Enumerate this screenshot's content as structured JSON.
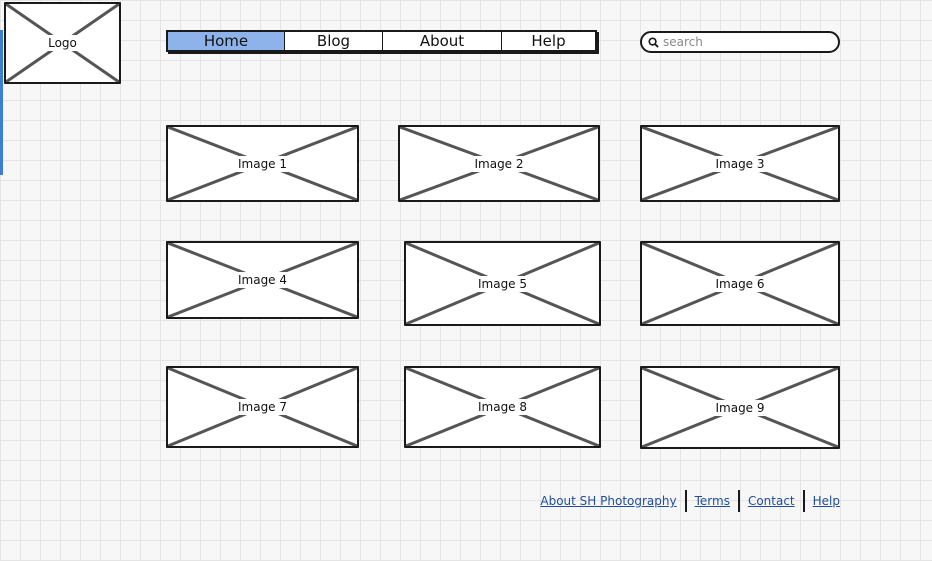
{
  "logo": {
    "label": "Logo"
  },
  "nav": {
    "items": [
      {
        "label": "Home",
        "active": true
      },
      {
        "label": "Blog",
        "active": false
      },
      {
        "label": "About",
        "active": false
      },
      {
        "label": "Help",
        "active": false
      }
    ]
  },
  "search": {
    "placeholder": "search",
    "value": ""
  },
  "gallery": {
    "images": [
      {
        "label": "Image 1"
      },
      {
        "label": "Image 2"
      },
      {
        "label": "Image 3"
      },
      {
        "label": "Image 4"
      },
      {
        "label": "Image 5"
      },
      {
        "label": "Image 6"
      },
      {
        "label": "Image 7"
      },
      {
        "label": "Image 8"
      },
      {
        "label": "Image 9"
      }
    ]
  },
  "footer": {
    "links": [
      {
        "label": "About SH Photography"
      },
      {
        "label": "Terms"
      },
      {
        "label": "Contact"
      },
      {
        "label": "Help"
      }
    ]
  },
  "colors": {
    "nav_active": "#8db3ea",
    "link": "#1f4e9c",
    "accent": "#3b7fd1"
  }
}
